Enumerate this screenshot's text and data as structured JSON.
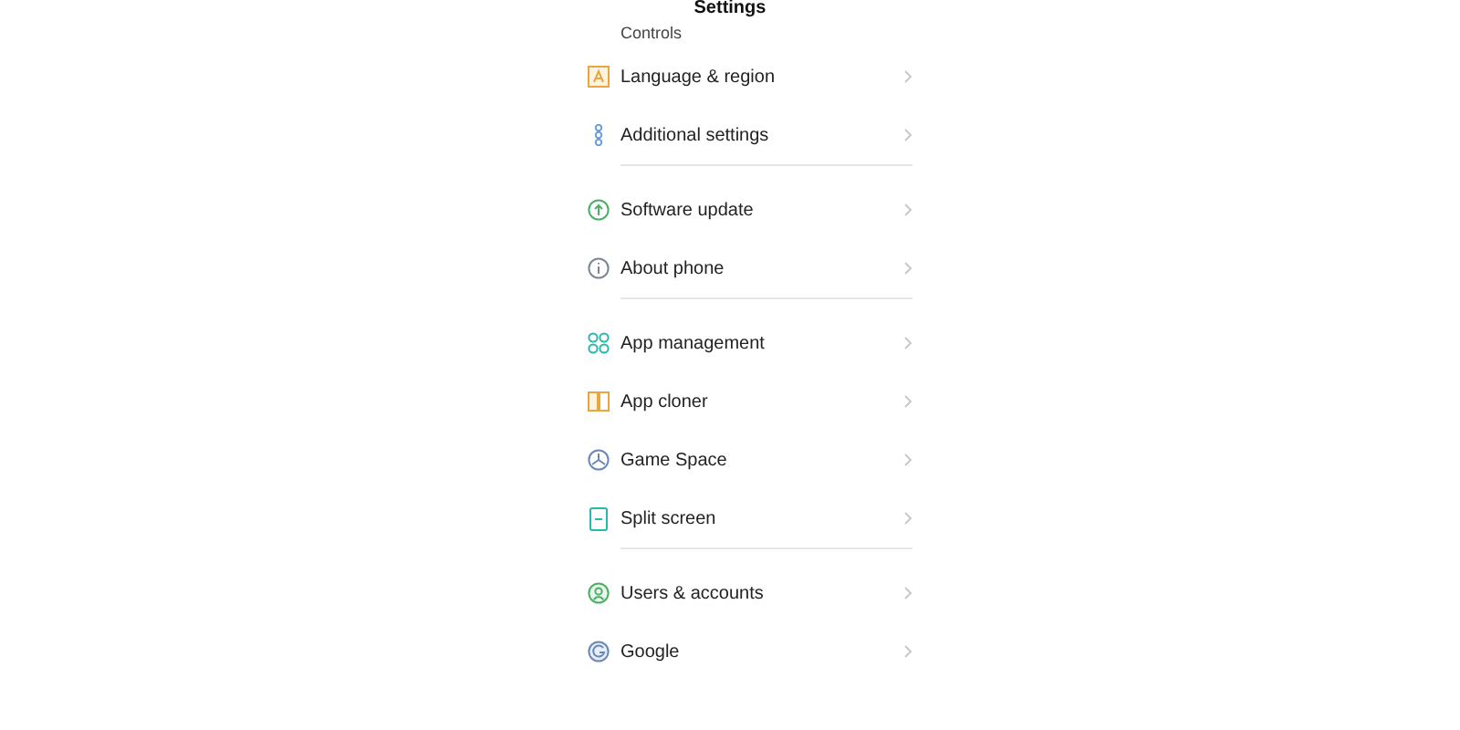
{
  "header": {
    "title": "Settings"
  },
  "partial_item": "Controls",
  "groups": [
    {
      "items": [
        {
          "label": "Language & region"
        },
        {
          "label": "Additional settings"
        }
      ]
    },
    {
      "items": [
        {
          "label": "Software update"
        },
        {
          "label": "About phone"
        }
      ]
    },
    {
      "items": [
        {
          "label": "App management"
        },
        {
          "label": "App cloner"
        },
        {
          "label": "Game Space"
        },
        {
          "label": "Split screen"
        }
      ]
    },
    {
      "items": [
        {
          "label": "Users & accounts"
        },
        {
          "label": "Google"
        }
      ]
    }
  ]
}
